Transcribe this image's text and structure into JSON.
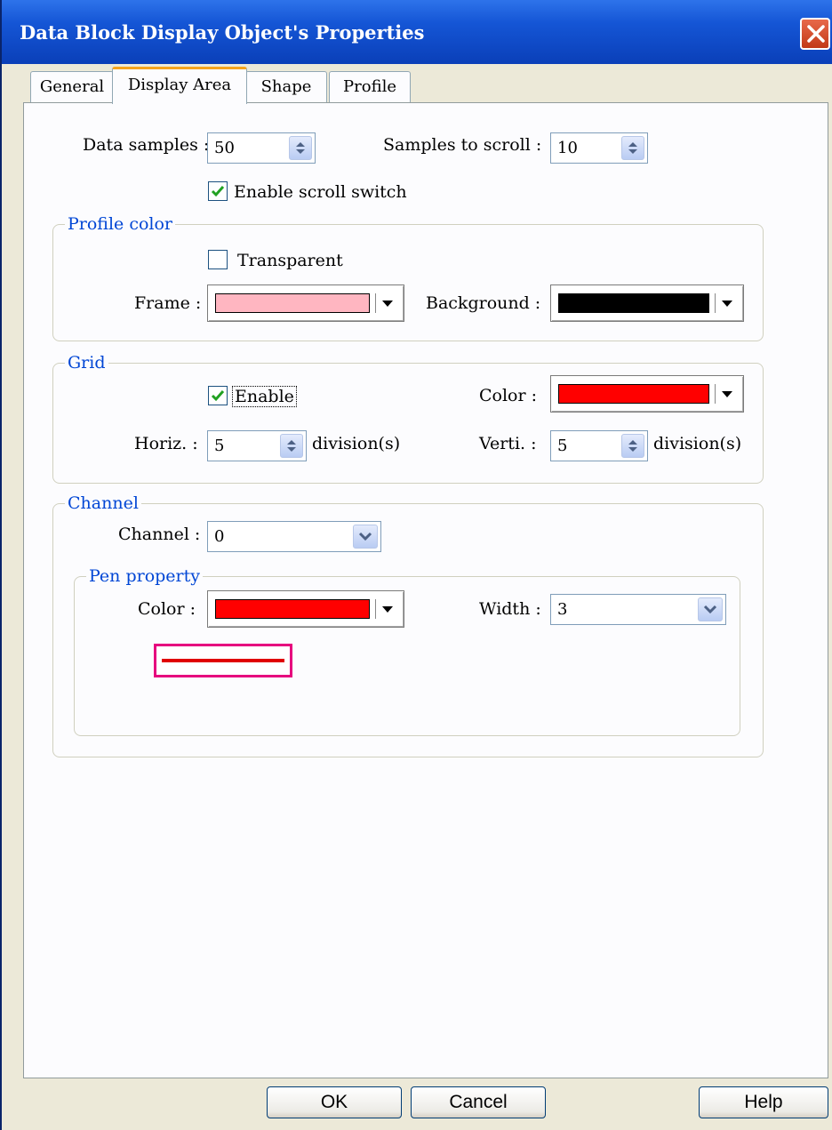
{
  "window": {
    "title": "Data Block Display Object's Properties"
  },
  "tabs": [
    {
      "label": "General",
      "active": false
    },
    {
      "label": "Display Area",
      "active": true
    },
    {
      "label": "Shape",
      "active": false
    },
    {
      "label": "Profile",
      "active": false
    }
  ],
  "display_area": {
    "data_samples_label": "Data samples :",
    "data_samples_value": "50",
    "samples_to_scroll_label": "Samples to scroll  :",
    "samples_to_scroll_value": "10",
    "enable_scroll_switch_label": "Enable scroll switch",
    "enable_scroll_switch_checked": true
  },
  "profile_color": {
    "group_title": "Profile color",
    "transparent_label": "Transparent",
    "transparent_checked": false,
    "frame_label": "Frame :",
    "frame_color": "#ffb6c1",
    "background_label": "Background :",
    "background_color": "#000000"
  },
  "grid": {
    "group_title": "Grid",
    "enable_label": "Enable",
    "enable_checked": true,
    "color_label": "Color :",
    "color_value": "#ff0000",
    "horiz_label": "Horiz. :",
    "horiz_value": "5",
    "horiz_unit": "division(s)",
    "verti_label": "Verti.  :",
    "verti_value": "5",
    "verti_unit": "division(s)"
  },
  "channel": {
    "group_title": "Channel",
    "channel_label": "Channel :",
    "channel_value": "0",
    "pen_property": {
      "group_title": "Pen property",
      "color_label": "Color :",
      "color_value": "#ff0000",
      "width_label": "Width :",
      "width_value": "3",
      "preview_frame_color": "#e6007e"
    }
  },
  "footer": {
    "ok_label": "OK",
    "cancel_label": "Cancel",
    "help_label": "Help"
  },
  "colors": {
    "titlebar": "#1556d6",
    "group_title": "#0046d5",
    "active_tab_accent": "#f5a31b",
    "checkmark": "#21a121"
  }
}
